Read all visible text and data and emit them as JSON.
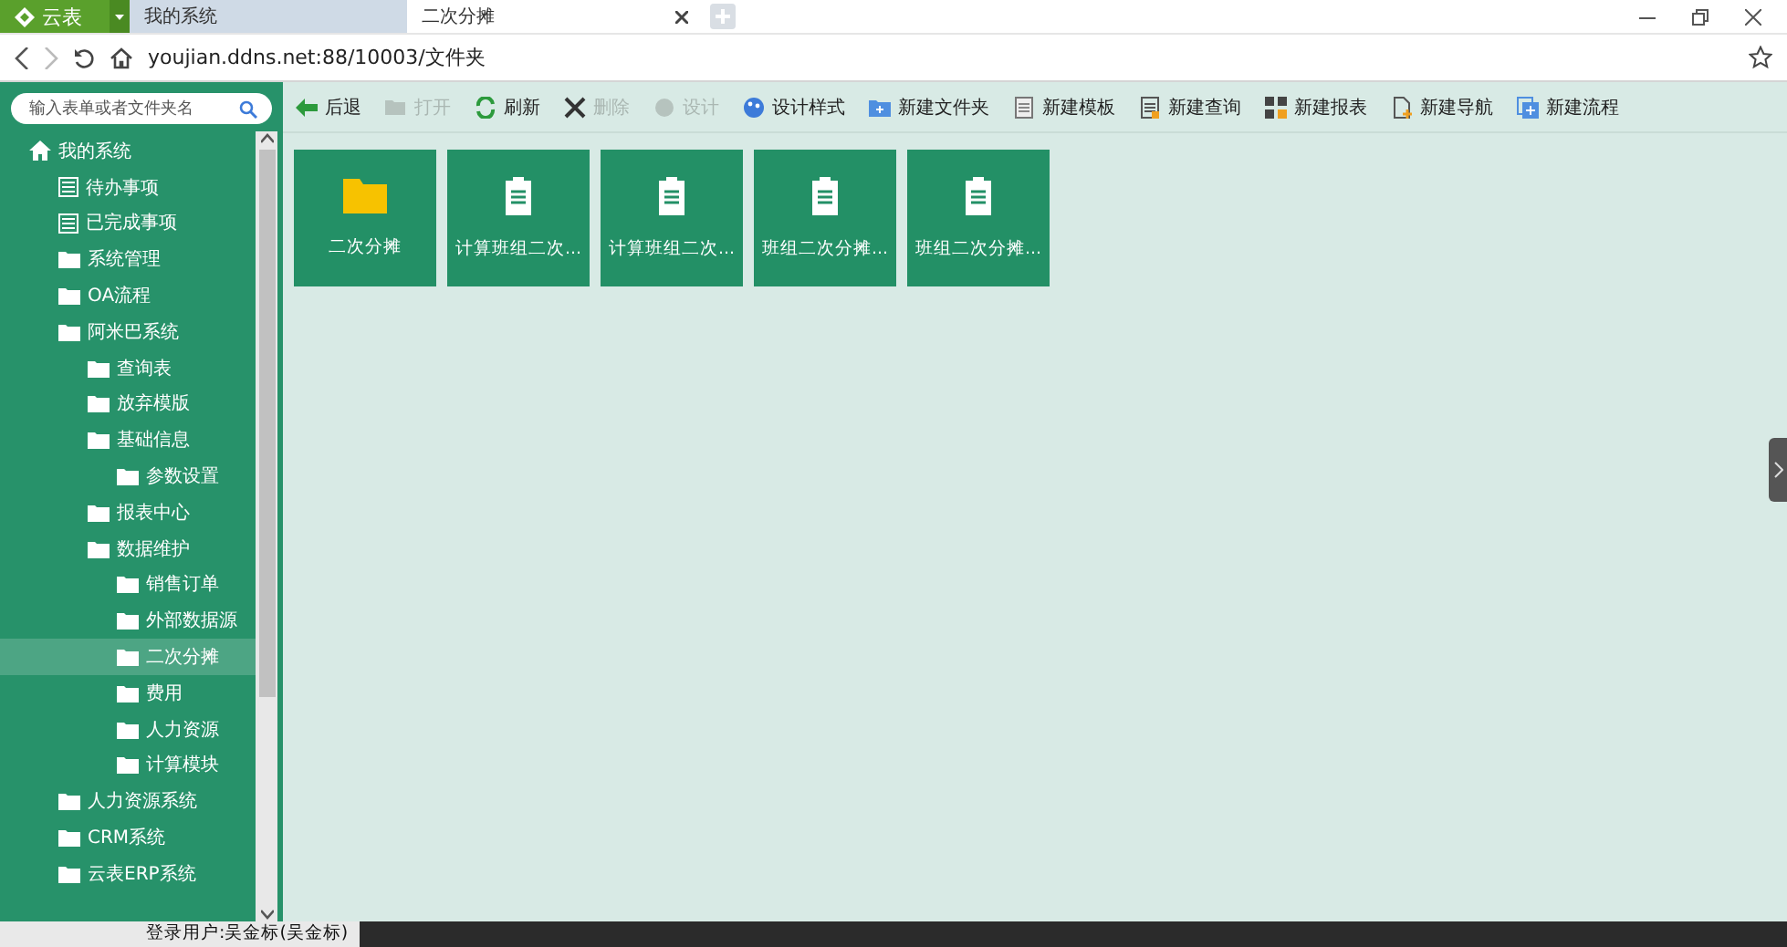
{
  "browser": {
    "app_menu": "云表",
    "tabs": [
      {
        "label": "我的系统",
        "selected": false
      },
      {
        "label": "二次分摊",
        "selected": true
      }
    ],
    "address": "youjian.ddns.net:88/10003/文件夹"
  },
  "search": {
    "placeholder": "输入表单或者文件夹名"
  },
  "sidebar": {
    "items": [
      {
        "label": "我的系统",
        "kind": "home",
        "selected": false,
        "children": [
          {
            "label": "待办事项",
            "kind": "list",
            "selected": false
          },
          {
            "label": "已完成事项",
            "kind": "list",
            "selected": false
          },
          {
            "label": "系统管理",
            "kind": "folder",
            "selected": false
          },
          {
            "label": "OA流程",
            "kind": "folder",
            "selected": false
          },
          {
            "label": "阿米巴系统",
            "kind": "folder",
            "selected": false,
            "children": [
              {
                "label": "查询表",
                "kind": "folder",
                "selected": false
              },
              {
                "label": "放弃模版",
                "kind": "folder",
                "selected": false
              },
              {
                "label": "基础信息",
                "kind": "folder",
                "selected": false,
                "children": [
                  {
                    "label": "参数设置",
                    "kind": "folder",
                    "selected": false
                  }
                ]
              },
              {
                "label": "报表中心",
                "kind": "folder",
                "selected": false
              },
              {
                "label": "数据维护",
                "kind": "folder",
                "selected": false,
                "children": [
                  {
                    "label": "销售订单",
                    "kind": "folder",
                    "selected": false
                  },
                  {
                    "label": "外部数据源",
                    "kind": "folder",
                    "selected": false
                  },
                  {
                    "label": "二次分摊",
                    "kind": "folder",
                    "selected": true
                  },
                  {
                    "label": "费用",
                    "kind": "folder",
                    "selected": false
                  },
                  {
                    "label": "人力资源",
                    "kind": "folder",
                    "selected": false
                  },
                  {
                    "label": "计算模块",
                    "kind": "folder",
                    "selected": false
                  }
                ]
              }
            ]
          },
          {
            "label": "人力资源系统",
            "kind": "folder",
            "selected": false
          },
          {
            "label": "CRM系统",
            "kind": "folder",
            "selected": false
          },
          {
            "label": "云表ERP系统",
            "kind": "folder",
            "selected": false
          }
        ]
      }
    ]
  },
  "toolbar": [
    {
      "label": "后退",
      "kind": "back",
      "disabled": false
    },
    {
      "label": "打开",
      "kind": "open",
      "disabled": true
    },
    {
      "label": "刷新",
      "kind": "refresh",
      "disabled": false
    },
    {
      "label": "删除",
      "kind": "delete",
      "disabled": true
    },
    {
      "label": "设计",
      "kind": "design",
      "disabled": true
    },
    {
      "label": "设计样式",
      "kind": "style",
      "disabled": false
    },
    {
      "label": "新建文件夹",
      "kind": "folder",
      "disabled": false
    },
    {
      "label": "新建模板",
      "kind": "template",
      "disabled": false
    },
    {
      "label": "新建查询",
      "kind": "query",
      "disabled": false
    },
    {
      "label": "新建报表",
      "kind": "report",
      "disabled": false
    },
    {
      "label": "新建导航",
      "kind": "nav",
      "disabled": false
    },
    {
      "label": "新建流程",
      "kind": "flow",
      "disabled": false
    }
  ],
  "tiles": [
    {
      "label": "二次分摊",
      "kind": "folder"
    },
    {
      "label": "计算班组二次...",
      "kind": "form"
    },
    {
      "label": "计算班组二次...",
      "kind": "form"
    },
    {
      "label": "班组二次分摊...",
      "kind": "form"
    },
    {
      "label": "班组二次分摊...",
      "kind": "form"
    }
  ],
  "status_bar": {
    "user": "登录用户:吴金标(吴金标)"
  }
}
